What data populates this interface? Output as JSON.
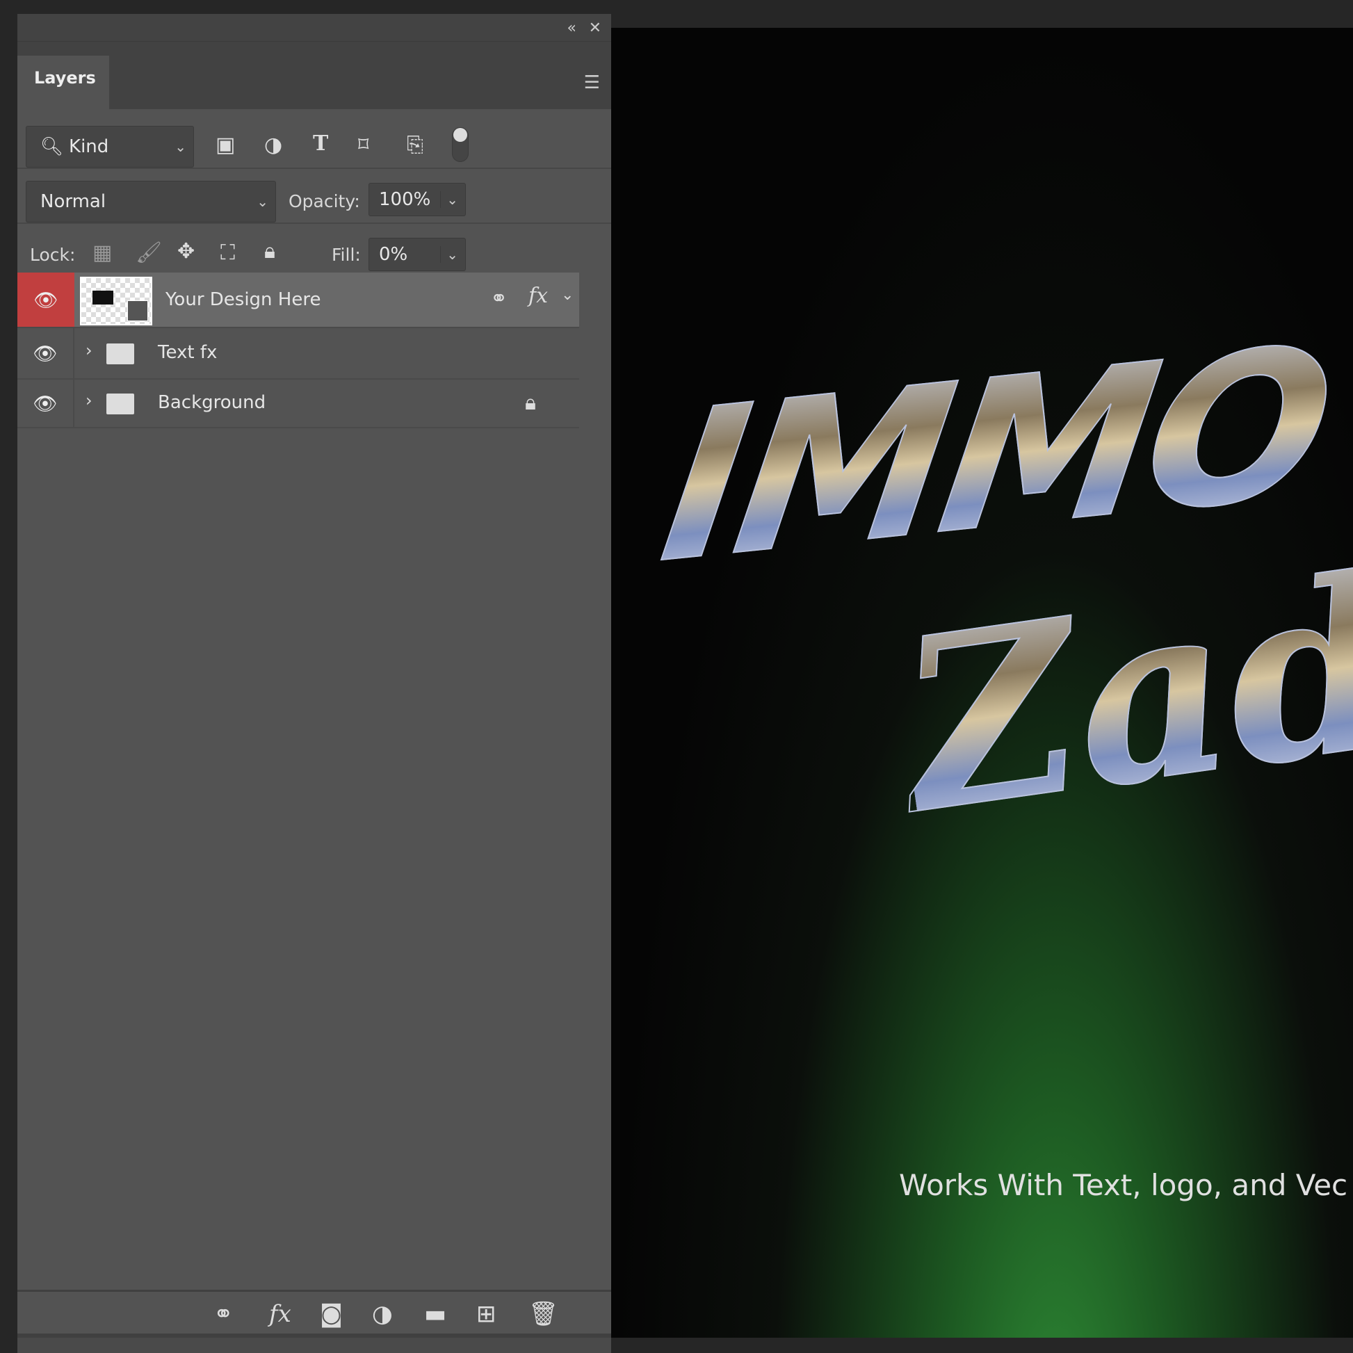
{
  "panel": {
    "tab_label": "Layers",
    "collapse_icon": "double-chevron-left-icon",
    "close_icon": "close-icon",
    "menu_icon": "hamburger-icon",
    "filter": {
      "kind_label": "Kind",
      "icons": [
        "image-filter-icon",
        "adjustment-filter-icon",
        "type-filter-icon",
        "shape-filter-icon",
        "smart-object-filter-icon"
      ],
      "toggle": "filter-toggle"
    },
    "blend_mode": "Normal",
    "opacity_label": "Opacity:",
    "opacity_value": "100%",
    "lock_label": "Lock:",
    "fill_label": "Fill:",
    "fill_value": "0%",
    "layers": [
      {
        "name": "Your Design Here",
        "type": "smart-object",
        "visible": true,
        "selected": true,
        "linked": true,
        "fx": "fx"
      },
      {
        "name": "Text fx",
        "type": "group",
        "visible": true
      },
      {
        "name": "Background",
        "type": "group",
        "visible": true,
        "locked": true
      }
    ],
    "bottom_icons": [
      "link-icon",
      "fx-icon",
      "mask-icon",
      "adjustment-icon",
      "folder-icon",
      "new-layer-icon",
      "trash-icon"
    ],
    "bottom_fx_label": "fx"
  },
  "canvas": {
    "title_line1": "IMMO",
    "title_line2": "Zad",
    "tagline": "Works With Text, logo, and Vec"
  },
  "colors": {
    "selected_eye": "#c13f3f",
    "panel": "#535353",
    "canvas_green": "#2e8a35"
  }
}
